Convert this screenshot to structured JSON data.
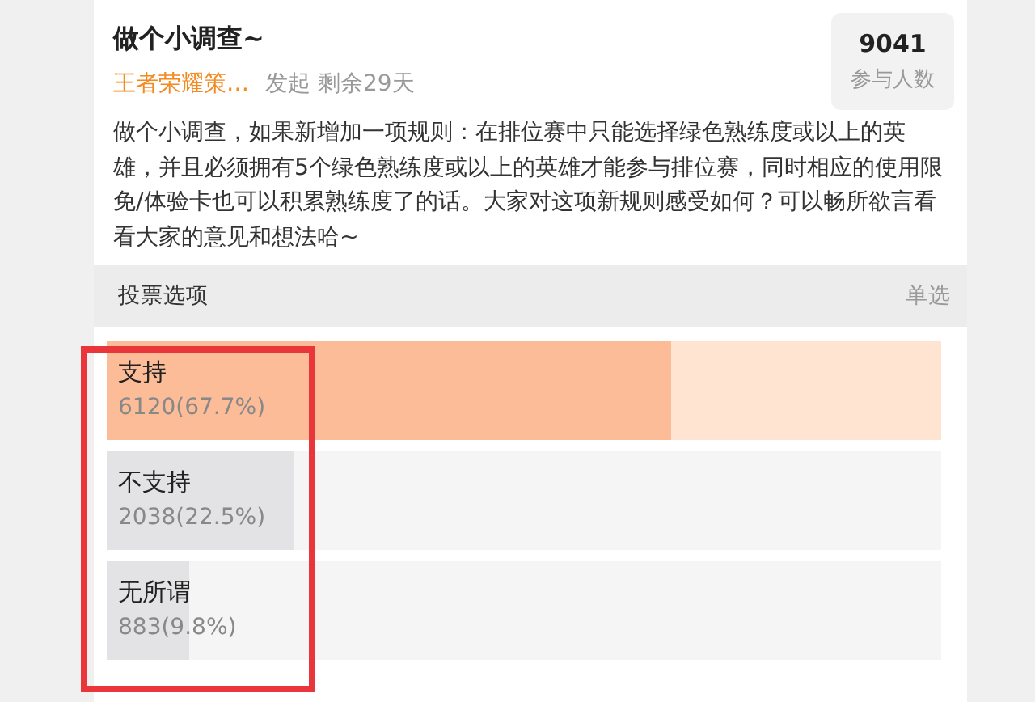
{
  "poll": {
    "title": "做个小调查~",
    "source": "王者荣耀策…",
    "meta": "发起 剩余29天",
    "stats": {
      "count": "9041",
      "label": "参与人数"
    },
    "description": "做个小调查，如果新增加一项规则：在排位赛中只能选择绿色熟练度或以上的英雄，并且必须拥有5个绿色熟练度或以上的英雄才能参与排位赛，同时相应的使用限免/体验卡也可以积累熟练度了的话。大家对这项新规则感受如何？可以畅所欲言看看大家的意见和想法哈~"
  },
  "options_header": {
    "title": "投票选项",
    "mode": "单选"
  },
  "options": [
    {
      "label": "支持",
      "result": "6120(67.7%)",
      "level": 0.677,
      "leading": true
    },
    {
      "label": "不支持",
      "result": "2038(22.5%)",
      "level": 0.225,
      "leading": false
    },
    {
      "label": "无所谓",
      "result": "883(9.8%)",
      "level": 0.098,
      "leading": false
    }
  ]
}
